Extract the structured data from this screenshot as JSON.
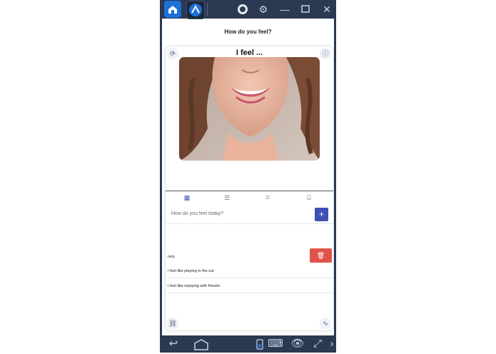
{
  "emulator": {
    "topbar_icons": [
      "home-icon",
      "app-icon",
      "account-icon",
      "settings-icon",
      "minimize-icon",
      "maximize-icon",
      "close-icon"
    ],
    "bottombar_icons": [
      "back-icon",
      "home-icon",
      "phone-icon",
      "keyboard-icon",
      "eye-icon",
      "fullscreen-icon",
      "chevron-right-icon"
    ],
    "accent": "#1e6fd9",
    "frame_color": "#2b3a52"
  },
  "app": {
    "title": "How do you feel?",
    "card": {
      "heading": "I feel ...",
      "refresh_icon": "⟳",
      "info_icon": "ⓘ",
      "link_icon": "⛓",
      "chart_icon": "∿"
    },
    "tabs": [
      {
        "icon": "grid-icon",
        "glyph": "▦",
        "active": true
      },
      {
        "icon": "list-icon",
        "glyph": "☰",
        "active": false
      },
      {
        "icon": "bookmark-icon",
        "glyph": "⌑",
        "active": false
      },
      {
        "icon": "camera-icon",
        "glyph": "⌸",
        "active": false
      }
    ],
    "input": {
      "placeholder": "How do you feel today?",
      "add_label": "+"
    },
    "items": [
      {
        "label": "nely",
        "delete_icon": "🗑"
      },
      {
        "label": "I feel like playing in the out"
      },
      {
        "label": "I feel like enjoying with friends"
      }
    ],
    "colors": {
      "add_button": "#3f51b5",
      "delete_button": "#e0534c"
    }
  }
}
